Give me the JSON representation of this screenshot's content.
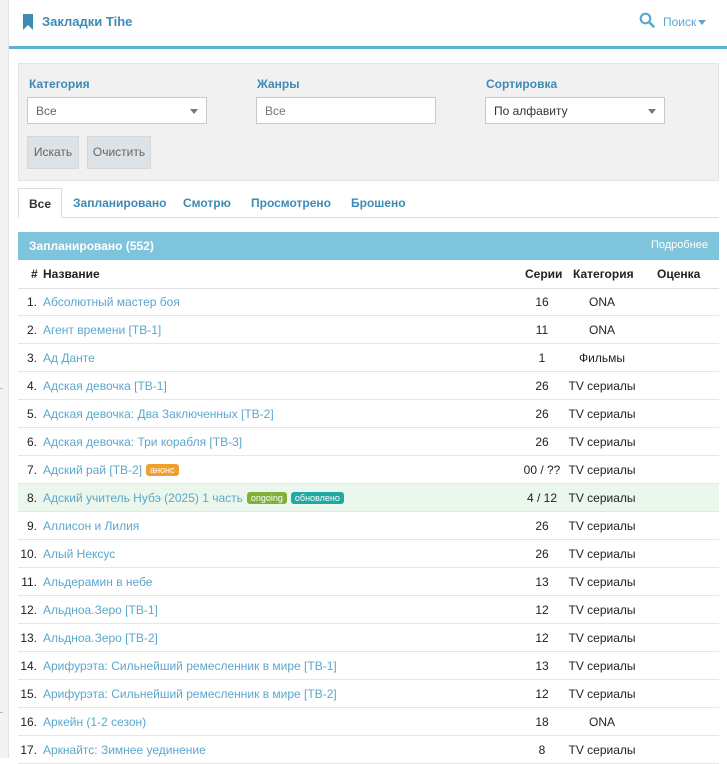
{
  "header": {
    "title": "Закладки Tihe",
    "search_label": "Поиск",
    "accent": "#5bb4d2"
  },
  "filters": {
    "category": {
      "label": "Категория",
      "value": "Все"
    },
    "genres": {
      "label": "Жанры",
      "placeholder": "Все"
    },
    "sort": {
      "label": "Сортировка",
      "value": "По алфавиту"
    },
    "search_button": "Искать",
    "clear_button": "Очистить"
  },
  "tabs": [
    {
      "label": "Все",
      "active": true
    },
    {
      "label": "Запланировано",
      "active": false
    },
    {
      "label": "Смотрю",
      "active": false
    },
    {
      "label": "Просмотрено",
      "active": false
    },
    {
      "label": "Брошено",
      "active": false
    }
  ],
  "panel": {
    "title": "Запланировано (552)",
    "more": "Подробнее"
  },
  "table": {
    "columns": {
      "num": "#",
      "name": "Название",
      "episodes": "Серии",
      "category": "Категория",
      "score": "Оценка"
    },
    "rows": [
      {
        "num": "1.",
        "name": "Абсолютный мастер боя",
        "episodes": "16",
        "category": "ONA",
        "score": ""
      },
      {
        "num": "2.",
        "name": "Агент времени [ТВ-1]",
        "episodes": "11",
        "category": "ONA",
        "score": ""
      },
      {
        "num": "3.",
        "name": "Ад Данте",
        "episodes": "1",
        "category": "Фильмы",
        "score": ""
      },
      {
        "num": "4.",
        "name": "Адская девочка [ТВ-1]",
        "episodes": "26",
        "category": "TV сериалы",
        "score": ""
      },
      {
        "num": "5.",
        "name": "Адская девочка: Два Заключенных [ТВ-2]",
        "episodes": "26",
        "category": "TV сериалы",
        "score": ""
      },
      {
        "num": "6.",
        "name": "Адская девочка: Три корабля [ТВ-3]",
        "episodes": "26",
        "category": "TV сериалы",
        "score": ""
      },
      {
        "num": "7.",
        "name": "Адский рай [ТВ-2]",
        "episodes": "00 / ??",
        "category": "TV сериалы",
        "score": "",
        "badges": [
          "анонс"
        ]
      },
      {
        "num": "8.",
        "name": "Адский учитель Нубэ (2025) 1 часть",
        "episodes": "4 / 12",
        "category": "TV сериалы",
        "score": "",
        "badges": [
          "ongoing",
          "обновлено"
        ],
        "highlight": true
      },
      {
        "num": "9.",
        "name": "Аллисон и Лилия",
        "episodes": "26",
        "category": "TV сериалы",
        "score": ""
      },
      {
        "num": "10.",
        "name": "Алый Нексус",
        "episodes": "26",
        "category": "TV сериалы",
        "score": ""
      },
      {
        "num": "11.",
        "name": "Альдерамин в небе",
        "episodes": "13",
        "category": "TV сериалы",
        "score": ""
      },
      {
        "num": "12.",
        "name": "Альдноа.Зеро [ТВ-1]",
        "episodes": "12",
        "category": "TV сериалы",
        "score": ""
      },
      {
        "num": "13.",
        "name": "Альдноа.Зеро [ТВ-2]",
        "episodes": "12",
        "category": "TV сериалы",
        "score": ""
      },
      {
        "num": "14.",
        "name": "Арифурэта: Сильнейший ремесленник в мире [ТВ-1]",
        "episodes": "13",
        "category": "TV сериалы",
        "score": ""
      },
      {
        "num": "15.",
        "name": "Арифурэта: Сильнейший ремесленник в мире [ТВ-2]",
        "episodes": "12",
        "category": "TV сериалы",
        "score": ""
      },
      {
        "num": "16.",
        "name": "Аркейн (1-2 сезон)",
        "episodes": "18",
        "category": "ONA",
        "score": ""
      },
      {
        "num": "17.",
        "name": "Аркнайтс: Зимнее уединение",
        "episodes": "8",
        "category": "TV сериалы",
        "score": ""
      }
    ]
  },
  "icons": {
    "bookmark": "bookmark-icon",
    "search": "search-icon",
    "caret": "chevron-down-icon"
  }
}
